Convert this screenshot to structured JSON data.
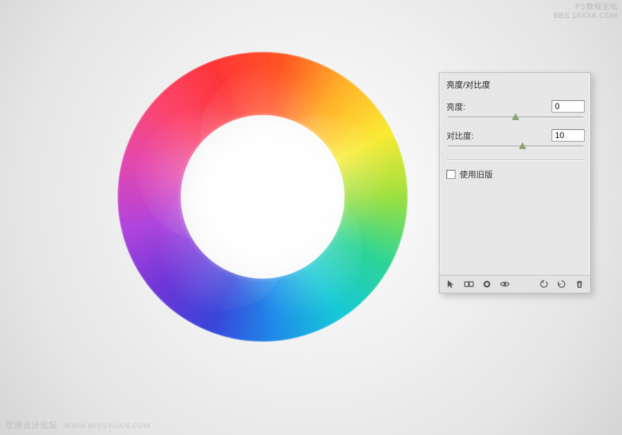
{
  "panel": {
    "title": "亮度/对比度",
    "brightness": {
      "label": "亮度:",
      "value": "0",
      "pos_pct": 50
    },
    "contrast": {
      "label": "对比度:",
      "value": "10",
      "pos_pct": 55
    },
    "legacy": {
      "label": "使用旧版",
      "checked": false
    }
  },
  "footer_icons": {
    "pointer": "pointer-icon",
    "view": "view-states-icon",
    "mask": "mask-icon",
    "eye": "visibility-icon",
    "prev": "previous-state-icon",
    "reset": "reset-icon",
    "trash": "delete-icon"
  },
  "watermarks": {
    "top1": "PS教程论坛",
    "top2": "BBS.16XX8.COM",
    "bottom_label": "思缘设计论坛",
    "bottom_url": "WWW.MISSYUAN.COM"
  }
}
